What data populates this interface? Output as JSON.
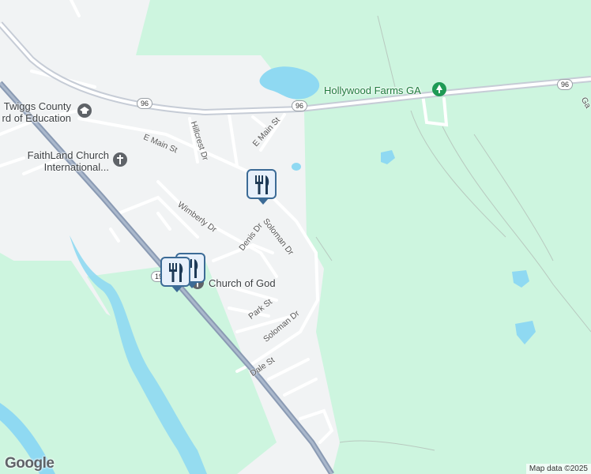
{
  "map": {
    "colors": {
      "land_green": "#cdf5df",
      "town": "#f1f3f4",
      "water": "#8fd9f2",
      "road": "#ffffff",
      "highway": "#9aa7bd",
      "pin_border": "#3c6b96",
      "park_icon": "#1e9a55",
      "school_icon": "#5f6368"
    },
    "places": {
      "board_of_education": "Twiggs County\nrd of Education",
      "church1": "FaithLand Church\nInternational...",
      "church2": "Church of God",
      "farm": "Hollywood Farms GA"
    },
    "streets": {
      "e_main_st_1": "E Main St",
      "e_main_st_2": "E Main St",
      "hillcrest": "Hillcrest Dr",
      "wimberly": "Wimberly Dr",
      "denis": "Denis Dr",
      "soloman_1": "Soloman Dr",
      "soloman_2": "Soloman Dr",
      "park": "Park St",
      "dale": "Dale St",
      "ga_partial": "Ga"
    },
    "route_shields": {
      "r96_a": "96",
      "r96_b": "96",
      "r96_c": "96",
      "r19": "19"
    },
    "icons": {
      "restaurant": "restaurant-icon",
      "park": "park-icon",
      "school": "school-icon",
      "church": "church-icon"
    },
    "logo": "Google",
    "attribution": "Map data ©2025"
  }
}
